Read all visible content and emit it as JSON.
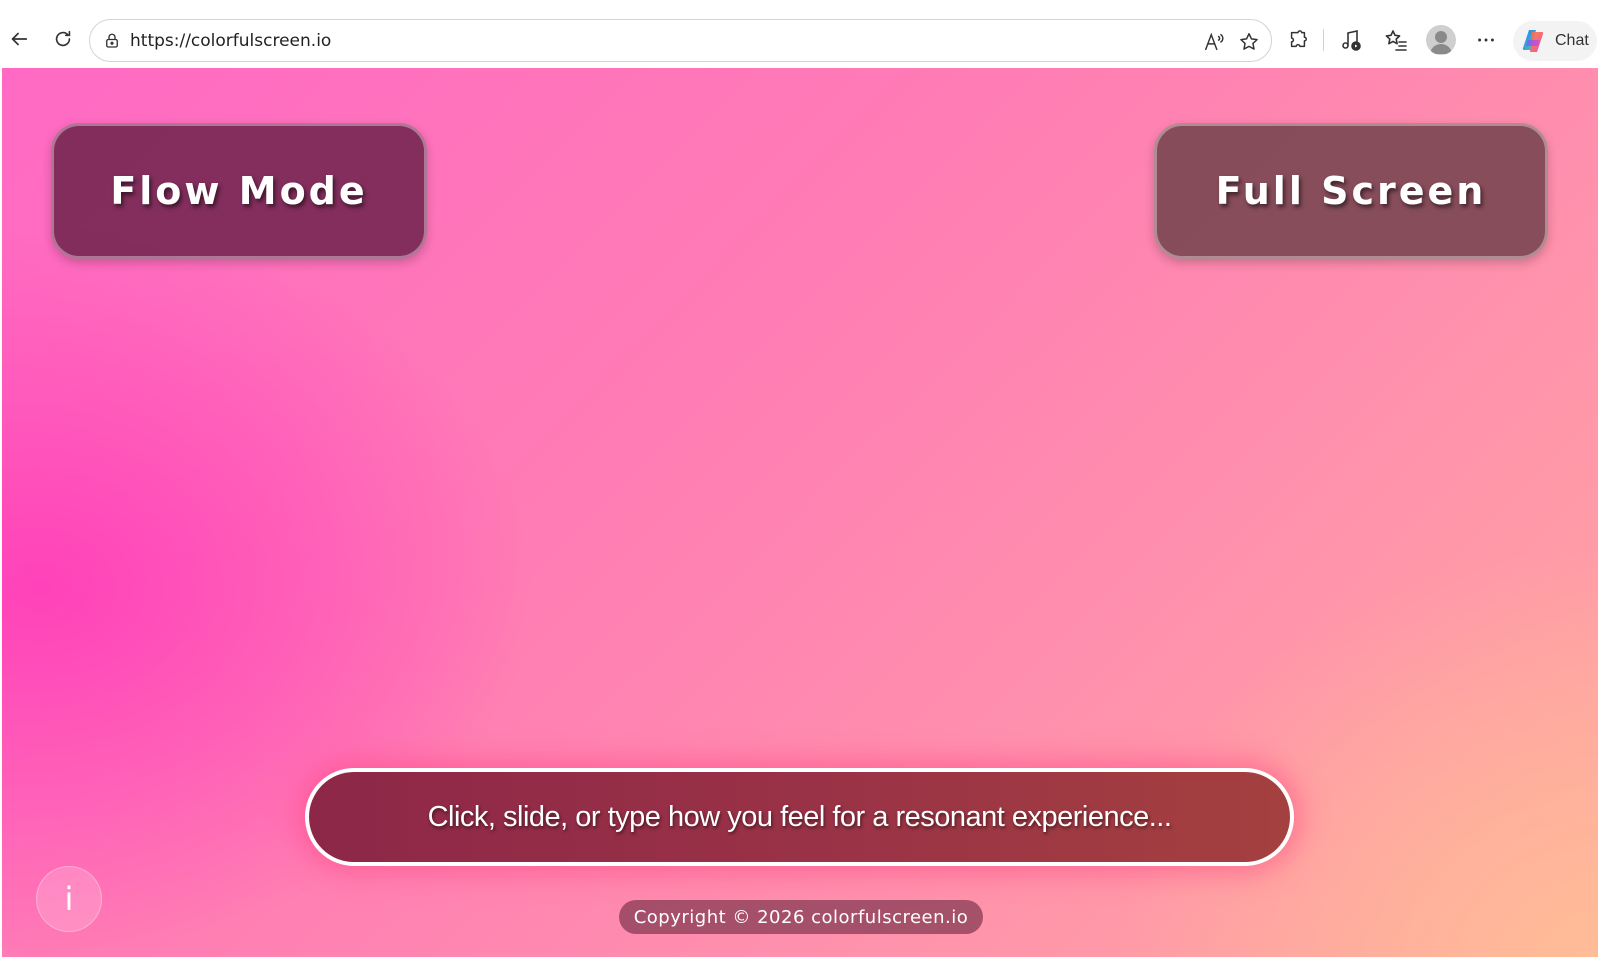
{
  "browser": {
    "url": "https://colorfulscreen.io",
    "chat_label": "Chat",
    "icons": {
      "back": "back-arrow-icon",
      "refresh": "refresh-icon",
      "lock": "lock-icon",
      "read_aloud": "read-aloud-icon",
      "favorite": "star-icon",
      "extensions": "extensions-icon",
      "media": "media-control-icon",
      "favorites_bar": "favorites-icon",
      "profile": "profile-avatar",
      "more": "more-icon",
      "chat": "copilot-icon"
    }
  },
  "page": {
    "flow_mode_label": "Flow Mode",
    "full_screen_label": "Full Screen",
    "mood_prompt": "Click, slide, or type how you feel for a resonant experience...",
    "info_label": "i",
    "copyright": "Copyright © 2026 colorfulscreen.io"
  },
  "colors": {
    "background_start": "#ff3cb9",
    "background_end": "#ffbe96",
    "flow_button": "#78285b",
    "full_screen_button": "#7d4852",
    "input_background": "#8d2748"
  }
}
